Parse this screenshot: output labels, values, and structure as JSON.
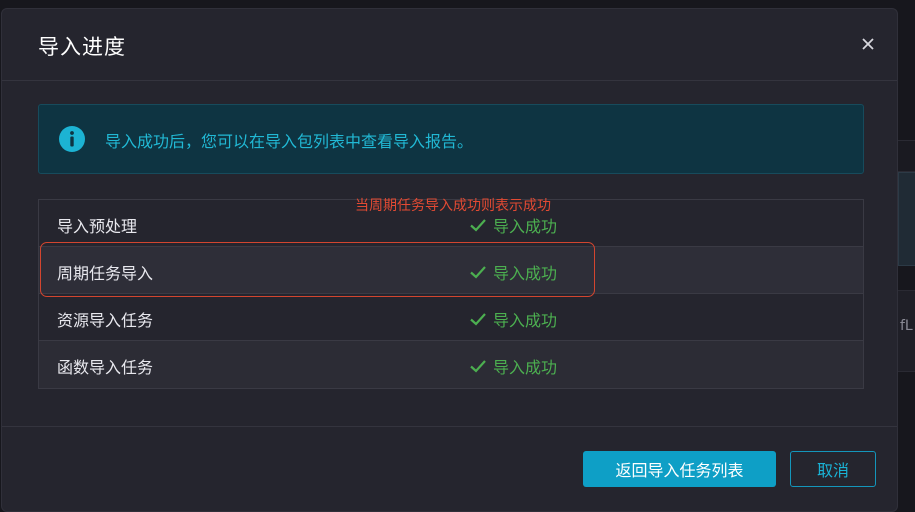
{
  "dialog": {
    "title": "导入进度"
  },
  "alert": {
    "icon": "info-icon",
    "message": "导入成功后，您可以在导入包列表中查看导入报告。"
  },
  "tasks": [
    {
      "name": "导入预处理",
      "status": "导入成功"
    },
    {
      "name": "周期任务导入",
      "status": "导入成功"
    },
    {
      "name": "资源导入任务",
      "status": "导入成功"
    },
    {
      "name": "函数导入任务",
      "status": "导入成功"
    }
  ],
  "annotation": {
    "text": "当周期任务导入成功则表示成功",
    "color": "#e24a33"
  },
  "footer": {
    "primary_label": "返回导入任务列表",
    "cancel_label": "取消"
  },
  "background": {
    "glyph": "fL"
  },
  "colors": {
    "accent": "#0e9fc6",
    "success": "#4caf50",
    "info": "#21b8d4"
  }
}
